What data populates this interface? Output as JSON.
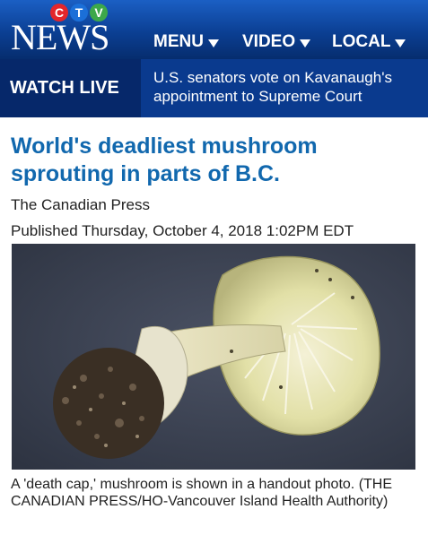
{
  "header": {
    "logo_ctv": [
      "C",
      "T",
      "V"
    ],
    "logo_news": "NEWS",
    "nav": [
      {
        "label": "MENU"
      },
      {
        "label": "VIDEO"
      },
      {
        "label": "LOCAL"
      }
    ],
    "colors": {
      "ctv_c": "#e3262b",
      "ctv_t": "#1b6fd8",
      "ctv_v": "#3da84a",
      "bar_top": "#1b5fc4",
      "bar_bottom": "#062d6e"
    }
  },
  "live_bar": {
    "watch_live": "WATCH LIVE",
    "breaking_text": "U.S. senators vote on Kavanaugh's appointment to Supreme Court"
  },
  "article": {
    "title": "World's deadliest mushroom sprouting in parts of B.C.",
    "byline": "The Canadian Press",
    "published": "Published Thursday, October 4, 2018 1:02PM EDT",
    "caption": "A 'death cap,' mushroom is shown in a handout photo. (THE CANADIAN PRESS/HO-Vancouver Island Health Authority)"
  }
}
